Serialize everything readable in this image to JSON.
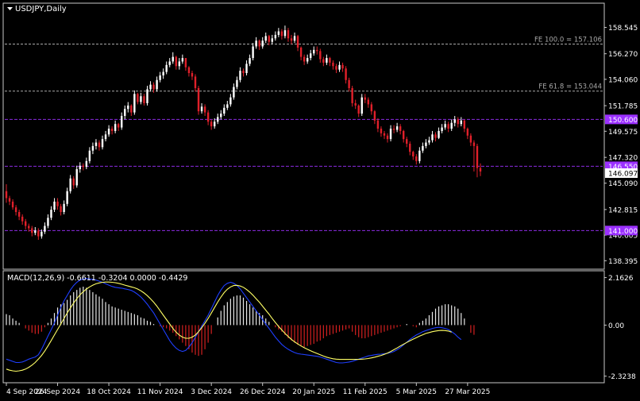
{
  "window": {
    "title": "USDJPY,Daily",
    "menu_icon": "triangle-down-icon"
  },
  "colors": {
    "background": "#000000",
    "frame": "#c8c8c8",
    "text": "#ffffff",
    "bull_candle": "#ffffff",
    "bear_candle": "#e0202a",
    "fib_line": "#a8a8a8",
    "level_line": "#8a2be2",
    "level_label_bg": "#9b30ff",
    "price_tag_bg": "#ffffff",
    "price_tag_text": "#000000",
    "macd_line": "#1f3fff",
    "signal_line": "#ffff66",
    "hist_pos": "#e8e8e8",
    "hist_neg": "#d42020"
  },
  "chart_data": [
    {
      "type": "candlestick",
      "title": "USDJPY,Daily",
      "y_ticks": [
        "158.545",
        "156.270",
        "154.060",
        "151.785",
        "149.575",
        "147.320",
        "145.090",
        "142.815",
        "140.605",
        "138.395"
      ],
      "y_tick_values": [
        158.545,
        156.27,
        154.06,
        151.785,
        149.575,
        147.32,
        145.09,
        142.815,
        140.605,
        138.395
      ],
      "x_ticks": [
        "4 Sep 2024",
        "26 Sep 2024",
        "18 Oct 2024",
        "11 Nov 2024",
        "3 Dec 2024",
        "26 Dec 2024",
        "20 Jan 2025",
        "11 Feb 2025",
        "5 Mar 2025",
        "27 Mar 2025"
      ],
      "x_tick_bar_index": [
        0,
        16,
        32,
        48,
        64,
        80,
        96,
        112,
        128,
        144
      ],
      "ylim": [
        137.8,
        160.5
      ],
      "fib_levels": [
        {
          "label": "FE 100.0 = 157.106",
          "value": 157.106
        },
        {
          "label": "FE 61.8 = 153.044",
          "value": 153.044
        }
      ],
      "horizontal_levels": [
        {
          "label": "150.600",
          "value": 150.6
        },
        {
          "label": "146.550",
          "value": 146.55
        },
        {
          "label": "141.000",
          "value": 141.0
        }
      ],
      "current_price_label": "146.097",
      "current_price": 146.097,
      "close_series": [
        143.8,
        143.5,
        143.0,
        142.6,
        142.2,
        141.8,
        141.4,
        141.2,
        140.8,
        141.0,
        140.5,
        140.9,
        141.4,
        142.1,
        142.8,
        143.5,
        143.1,
        142.6,
        143.3,
        144.4,
        145.5,
        144.9,
        146.3,
        146.6,
        146.5,
        147.0,
        147.9,
        148.3,
        148.6,
        148.2,
        148.9,
        149.3,
        149.8,
        149.6,
        150.2,
        149.9,
        150.9,
        151.5,
        151.8,
        151.2,
        152.8,
        152.1,
        152.6,
        152.0,
        153.2,
        153.6,
        153.2,
        154.0,
        154.4,
        154.7,
        155.3,
        155.6,
        156.0,
        155.2,
        155.6,
        155.9,
        155.1,
        154.6,
        154.3,
        153.3,
        151.3,
        151.7,
        151.2,
        150.4,
        150.0,
        150.4,
        150.8,
        151.1,
        151.6,
        151.9,
        152.5,
        153.4,
        154.0,
        154.8,
        154.6,
        155.4,
        155.9,
        156.9,
        157.4,
        156.9,
        157.4,
        157.8,
        157.3,
        157.6,
        157.9,
        158.2,
        157.8,
        158.3,
        157.6,
        157.4,
        157.8,
        156.8,
        156.0,
        155.6,
        155.9,
        156.3,
        156.6,
        156.5,
        155.8,
        155.5,
        155.9,
        155.5,
        155.2,
        154.9,
        155.3,
        155.0,
        154.0,
        153.3,
        152.0,
        151.8,
        151.1,
        152.5,
        152.3,
        151.9,
        151.3,
        150.5,
        149.8,
        149.4,
        149.2,
        148.9,
        149.8,
        149.7,
        150.0,
        149.6,
        148.9,
        148.5,
        147.8,
        147.4,
        147.0,
        147.9,
        148.3,
        148.6,
        148.8,
        149.3,
        149.0,
        149.6,
        149.9,
        150.2,
        149.8,
        150.3,
        150.6,
        150.2,
        150.5,
        149.8,
        149.2,
        148.6,
        148.3,
        146.4,
        146.1
      ],
      "open_series": [
        144.4,
        143.8,
        143.5,
        143.0,
        142.6,
        142.2,
        141.8,
        141.4,
        141.2,
        140.8,
        141.0,
        140.5,
        140.9,
        141.4,
        142.1,
        142.8,
        143.5,
        143.1,
        142.6,
        143.3,
        144.4,
        145.5,
        144.9,
        146.3,
        146.6,
        146.5,
        147.0,
        147.9,
        148.3,
        148.6,
        148.2,
        148.9,
        149.3,
        149.8,
        149.6,
        150.2,
        149.9,
        150.9,
        151.5,
        151.8,
        151.2,
        152.8,
        152.1,
        152.6,
        152.0,
        153.2,
        153.6,
        153.2,
        154.0,
        154.4,
        154.7,
        155.3,
        155.6,
        156.0,
        155.2,
        155.6,
        155.9,
        155.1,
        154.6,
        154.3,
        153.3,
        151.3,
        151.7,
        151.2,
        150.4,
        150.0,
        150.4,
        150.8,
        151.1,
        151.6,
        151.9,
        152.5,
        153.4,
        154.0,
        154.8,
        154.6,
        155.4,
        155.9,
        156.9,
        157.4,
        156.9,
        157.4,
        157.8,
        157.3,
        157.6,
        157.9,
        158.2,
        157.8,
        158.3,
        157.6,
        157.4,
        157.8,
        156.8,
        156.0,
        155.6,
        155.9,
        156.3,
        156.6,
        156.5,
        155.8,
        155.5,
        155.9,
        155.5,
        155.2,
        154.9,
        155.3,
        155.0,
        154.0,
        153.3,
        152.0,
        151.8,
        151.1,
        152.5,
        152.3,
        151.9,
        151.3,
        150.5,
        149.8,
        149.4,
        149.2,
        148.9,
        149.8,
        149.7,
        150.0,
        149.6,
        148.9,
        148.5,
        147.8,
        147.4,
        147.0,
        147.9,
        148.3,
        148.6,
        148.8,
        149.3,
        149.0,
        149.6,
        149.9,
        150.2,
        149.8,
        150.3,
        150.6,
        150.2,
        150.5,
        149.8,
        149.2,
        148.6,
        148.3,
        146.4
      ],
      "high_series": [
        145.0,
        144.0,
        143.7,
        143.2,
        142.8,
        142.4,
        142.0,
        141.6,
        141.4,
        141.3,
        141.2,
        141.1,
        141.7,
        142.4,
        143.1,
        143.8,
        143.8,
        143.3,
        143.6,
        144.7,
        145.8,
        145.7,
        146.6,
        146.9,
        146.8,
        147.3,
        148.2,
        148.6,
        148.9,
        148.8,
        149.2,
        149.6,
        150.1,
        150.0,
        150.5,
        150.3,
        151.2,
        151.8,
        152.1,
        151.9,
        153.1,
        152.9,
        152.9,
        152.8,
        153.5,
        153.9,
        153.8,
        154.3,
        154.7,
        155.0,
        155.6,
        155.9,
        156.4,
        156.1,
        155.9,
        156.2,
        155.9,
        155.2,
        154.8,
        154.5,
        153.5,
        152.0,
        151.9,
        151.4,
        150.6,
        150.7,
        151.1,
        151.4,
        151.9,
        152.2,
        152.8,
        153.7,
        154.3,
        155.1,
        155.0,
        155.7,
        156.2,
        157.2,
        157.7,
        157.5,
        157.7,
        158.1,
        157.9,
        157.9,
        158.2,
        158.5,
        158.4,
        158.7,
        158.5,
        157.9,
        158.1,
        157.9,
        156.9,
        156.2,
        156.2,
        156.6,
        156.9,
        156.9,
        156.7,
        156.0,
        156.2,
        156.0,
        155.7,
        155.4,
        155.6,
        155.5,
        155.2,
        154.2,
        153.5,
        152.3,
        151.9,
        152.8,
        152.8,
        152.5,
        152.1,
        151.4,
        150.7,
        150.0,
        149.6,
        149.4,
        150.1,
        150.1,
        150.3,
        150.2,
        149.7,
        149.1,
        148.7,
        147.9,
        147.6,
        148.2,
        148.6,
        148.9,
        149.1,
        149.6,
        149.5,
        149.9,
        150.2,
        150.5,
        150.4,
        150.6,
        150.9,
        150.8,
        150.8,
        150.6,
        149.9,
        149.4,
        148.8,
        148.5,
        146.8
      ],
      "low_series": [
        143.4,
        143.2,
        142.8,
        142.3,
        141.9,
        141.5,
        141.1,
        140.9,
        140.5,
        140.6,
        140.2,
        140.3,
        140.7,
        141.2,
        141.9,
        142.6,
        142.8,
        142.3,
        142.4,
        143.1,
        144.2,
        144.6,
        144.7,
        146.0,
        146.2,
        146.3,
        146.8,
        147.6,
        148.0,
        147.9,
        148.0,
        148.7,
        149.1,
        149.3,
        149.4,
        149.6,
        149.7,
        150.6,
        151.2,
        150.9,
        151.0,
        151.9,
        151.9,
        151.8,
        151.8,
        153.0,
        152.9,
        153.0,
        153.8,
        154.1,
        154.5,
        155.1,
        155.4,
        154.9,
        154.9,
        155.4,
        154.8,
        154.3,
        154.0,
        153.0,
        151.0,
        151.1,
        150.9,
        150.1,
        149.7,
        149.8,
        150.2,
        150.6,
        150.9,
        151.4,
        151.7,
        152.3,
        153.2,
        153.8,
        154.3,
        154.4,
        155.2,
        155.7,
        156.7,
        156.6,
        156.7,
        157.2,
        157.0,
        157.1,
        157.4,
        157.7,
        157.5,
        157.6,
        157.3,
        157.1,
        157.2,
        156.5,
        155.7,
        155.3,
        155.4,
        155.7,
        156.1,
        156.2,
        155.5,
        155.2,
        155.3,
        155.2,
        154.9,
        154.6,
        154.7,
        154.7,
        153.7,
        153.0,
        151.7,
        151.5,
        150.8,
        150.9,
        152.0,
        151.6,
        151.0,
        150.2,
        149.5,
        149.1,
        148.9,
        148.6,
        148.7,
        149.4,
        149.5,
        149.3,
        148.6,
        148.2,
        147.5,
        147.1,
        146.7,
        146.8,
        147.7,
        148.1,
        148.4,
        148.6,
        148.7,
        148.9,
        149.4,
        149.7,
        149.5,
        149.6,
        150.0,
        149.9,
        150.0,
        149.5,
        148.9,
        148.3,
        146.1,
        145.6,
        145.7
      ]
    },
    {
      "type": "bar+line",
      "title": "MACD(12,26,9) -0.6611 -0.3204 0.0000 -0.4429",
      "y_ticks": [
        "2.1626",
        "0.00",
        "-2.3238"
      ],
      "y_tick_values": [
        2.1626,
        0.0,
        -2.3238
      ],
      "ylim": [
        -2.55,
        2.4
      ],
      "series": [
        {
          "name": "",
          "kind": "histogram",
          "values": [
            0.5,
            0.45,
            0.3,
            0.2,
            0.1,
            0.0,
            -0.15,
            -0.25,
            -0.35,
            -0.4,
            -0.4,
            -0.3,
            -0.1,
            0.1,
            0.3,
            0.55,
            0.8,
            0.95,
            1.0,
            1.15,
            1.35,
            1.5,
            1.6,
            1.7,
            1.75,
            1.7,
            1.6,
            1.5,
            1.4,
            1.3,
            1.2,
            1.05,
            0.95,
            0.85,
            0.8,
            0.75,
            0.7,
            0.65,
            0.6,
            0.55,
            0.5,
            0.45,
            0.35,
            0.3,
            0.2,
            0.15,
            0.05,
            0.0,
            -0.05,
            -0.1,
            -0.15,
            -0.25,
            -0.35,
            -0.5,
            -0.65,
            -0.8,
            -0.95,
            -1.1,
            -1.25,
            -1.35,
            -1.4,
            -1.35,
            -1.1,
            -0.8,
            -0.4,
            0.0,
            0.35,
            0.65,
            0.9,
            1.05,
            1.2,
            1.3,
            1.35,
            1.35,
            1.25,
            1.1,
            0.95,
            0.8,
            0.65,
            0.55,
            0.45,
            0.3,
            0.15,
            0.0,
            -0.1,
            -0.2,
            -0.3,
            -0.45,
            -0.6,
            -0.7,
            -0.8,
            -0.9,
            -0.95,
            -1.0,
            -0.95,
            -0.9,
            -0.85,
            -0.75,
            -0.7,
            -0.6,
            -0.5,
            -0.45,
            -0.4,
            -0.35,
            -0.3,
            -0.25,
            -0.2,
            -0.15,
            -0.3,
            -0.45,
            -0.55,
            -0.6,
            -0.6,
            -0.55,
            -0.5,
            -0.45,
            -0.4,
            -0.35,
            -0.3,
            -0.25,
            -0.2,
            -0.15,
            -0.1,
            -0.05,
            0.0,
            0.05,
            0.0,
            -0.05,
            -0.1,
            0.1,
            0.2,
            0.3,
            0.45,
            0.6,
            0.75,
            0.85,
            0.9,
            0.95,
            0.95,
            0.9,
            0.85,
            0.75,
            0.55,
            0.3,
            0.0,
            -0.35,
            -0.44
          ]
        },
        {
          "name": "",
          "kind": "line",
          "values": [
            -1.55,
            -1.6,
            -1.65,
            -1.7,
            -1.7,
            -1.68,
            -1.62,
            -1.55,
            -1.5,
            -1.45,
            -1.35,
            -1.1,
            -0.8,
            -0.5,
            -0.2,
            0.1,
            0.45,
            0.8,
            1.1,
            1.35,
            1.6,
            1.8,
            1.95,
            2.05,
            2.1,
            2.12,
            2.1,
            2.08,
            2.05,
            2.0,
            1.95,
            1.88,
            1.82,
            1.76,
            1.72,
            1.7,
            1.68,
            1.65,
            1.62,
            1.58,
            1.5,
            1.4,
            1.28,
            1.12,
            0.95,
            0.75,
            0.55,
            0.3,
            0.05,
            -0.2,
            -0.45,
            -0.7,
            -0.9,
            -1.05,
            -1.15,
            -1.2,
            -1.15,
            -1.0,
            -0.8,
            -0.55,
            -0.3,
            -0.05,
            0.2,
            0.45,
            0.75,
            1.05,
            1.35,
            1.6,
            1.8,
            1.9,
            1.95,
            1.9,
            1.8,
            1.65,
            1.45,
            1.25,
            1.05,
            0.85,
            0.65,
            0.45,
            0.25,
            0.05,
            -0.15,
            -0.35,
            -0.55,
            -0.72,
            -0.88,
            -1.0,
            -1.1,
            -1.18,
            -1.25,
            -1.3,
            -1.32,
            -1.34,
            -1.36,
            -1.38,
            -1.4,
            -1.42,
            -1.45,
            -1.5,
            -1.55,
            -1.6,
            -1.65,
            -1.7,
            -1.72,
            -1.72,
            -1.7,
            -1.68,
            -1.65,
            -1.6,
            -1.55,
            -1.5,
            -1.45,
            -1.4,
            -1.38,
            -1.35,
            -1.33,
            -1.32,
            -1.3,
            -1.28,
            -1.25,
            -1.2,
            -1.12,
            -1.02,
            -0.9,
            -0.78,
            -0.65,
            -0.55,
            -0.45,
            -0.38,
            -0.3,
            -0.25,
            -0.2,
            -0.15,
            -0.12,
            -0.1,
            -0.12,
            -0.15,
            -0.2,
            -0.3,
            -0.4,
            -0.55,
            -0.66
          ]
        },
        {
          "name": "",
          "kind": "line",
          "values": [
            -2.0,
            -2.05,
            -2.08,
            -2.1,
            -2.08,
            -2.05,
            -2.0,
            -1.92,
            -1.82,
            -1.7,
            -1.55,
            -1.38,
            -1.18,
            -0.95,
            -0.7,
            -0.45,
            -0.2,
            0.05,
            0.3,
            0.55,
            0.78,
            1.0,
            1.2,
            1.38,
            1.52,
            1.64,
            1.74,
            1.82,
            1.88,
            1.92,
            1.95,
            1.96,
            1.96,
            1.95,
            1.93,
            1.9,
            1.86,
            1.82,
            1.78,
            1.74,
            1.7,
            1.64,
            1.56,
            1.46,
            1.34,
            1.2,
            1.04,
            0.86,
            0.66,
            0.45,
            0.25,
            0.05,
            -0.15,
            -0.32,
            -0.45,
            -0.55,
            -0.6,
            -0.6,
            -0.55,
            -0.45,
            -0.3,
            -0.12,
            0.08,
            0.3,
            0.55,
            0.8,
            1.05,
            1.28,
            1.48,
            1.63,
            1.74,
            1.8,
            1.81,
            1.78,
            1.72,
            1.62,
            1.5,
            1.36,
            1.2,
            1.04,
            0.86,
            0.68,
            0.5,
            0.3,
            0.12,
            -0.06,
            -0.22,
            -0.38,
            -0.52,
            -0.65,
            -0.76,
            -0.86,
            -0.95,
            -1.03,
            -1.1,
            -1.17,
            -1.23,
            -1.29,
            -1.35,
            -1.41,
            -1.46,
            -1.5,
            -1.53,
            -1.55,
            -1.56,
            -1.56,
            -1.56,
            -1.56,
            -1.56,
            -1.56,
            -1.56,
            -1.55,
            -1.54,
            -1.52,
            -1.49,
            -1.46,
            -1.42,
            -1.38,
            -1.33,
            -1.27,
            -1.2,
            -1.12,
            -1.04,
            -0.95,
            -0.87,
            -0.79,
            -0.71,
            -0.64,
            -0.57,
            -0.5,
            -0.44,
            -0.38,
            -0.34,
            -0.3,
            -0.27,
            -0.25,
            -0.24,
            -0.25,
            -0.27,
            -0.32
          ]
        }
      ]
    }
  ]
}
